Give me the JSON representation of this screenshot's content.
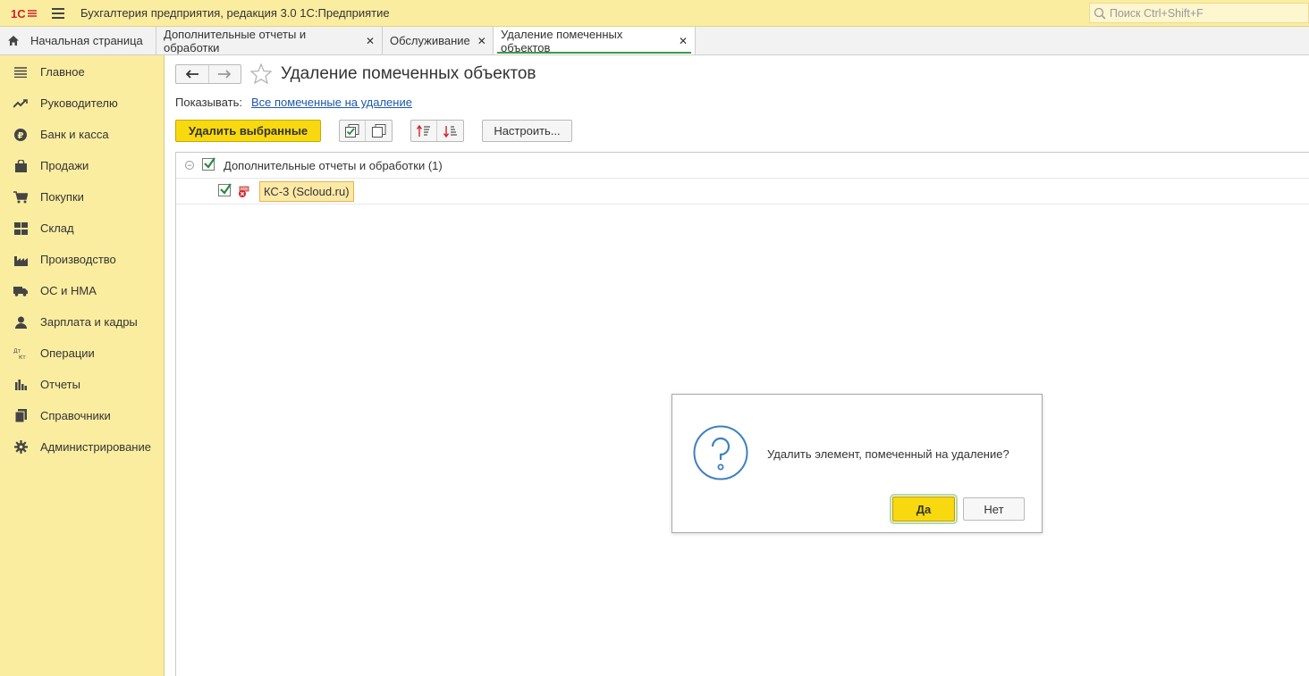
{
  "app": {
    "title": "Бухгалтерия предприятия, редакция 3.0 1С:Предприятие",
    "search_placeholder": "Поиск Ctrl+Shift+F"
  },
  "tabs": [
    {
      "label": "Начальная страница"
    },
    {
      "label": "Дополнительные отчеты и обработки"
    },
    {
      "label": "Обслуживание"
    },
    {
      "label": "Удаление помеченных объектов"
    }
  ],
  "sidebar": {
    "items": [
      {
        "label": "Главное",
        "icon": "list-icon"
      },
      {
        "label": "Руководителю",
        "icon": "trend-icon"
      },
      {
        "label": "Банк и касса",
        "icon": "ruble-coin-icon"
      },
      {
        "label": "Продажи",
        "icon": "bag-icon"
      },
      {
        "label": "Покупки",
        "icon": "cart-icon"
      },
      {
        "label": "Склад",
        "icon": "warehouse-icon"
      },
      {
        "label": "Производство",
        "icon": "factory-icon"
      },
      {
        "label": "ОС и НМА",
        "icon": "truck-icon"
      },
      {
        "label": "Зарплата и кадры",
        "icon": "person-icon"
      },
      {
        "label": "Операции",
        "icon": "dt-kt-icon"
      },
      {
        "label": "Отчеты",
        "icon": "bar-chart-icon"
      },
      {
        "label": "Справочники",
        "icon": "book-icon"
      },
      {
        "label": "Администрирование",
        "icon": "gear-icon"
      }
    ]
  },
  "page": {
    "title": "Удаление помеченных объектов",
    "show_label": "Показывать:",
    "show_value": "Все помеченные на удаление",
    "delete_selected": "Удалить выбранные",
    "configure": "Настроить..."
  },
  "tree": {
    "group": "Дополнительные отчеты и обработки (1)",
    "item": "КС-3 (Scloud.ru)"
  },
  "dialog": {
    "message": "Удалить элемент, помеченный на удаление?",
    "yes": "Да",
    "no": "Нет"
  },
  "colors": {
    "sidebar_bg": "#fbeda0",
    "accent_yellow": "#f8d90f",
    "link": "#1f58a6",
    "active_tab_line": "#3c9a4a"
  }
}
